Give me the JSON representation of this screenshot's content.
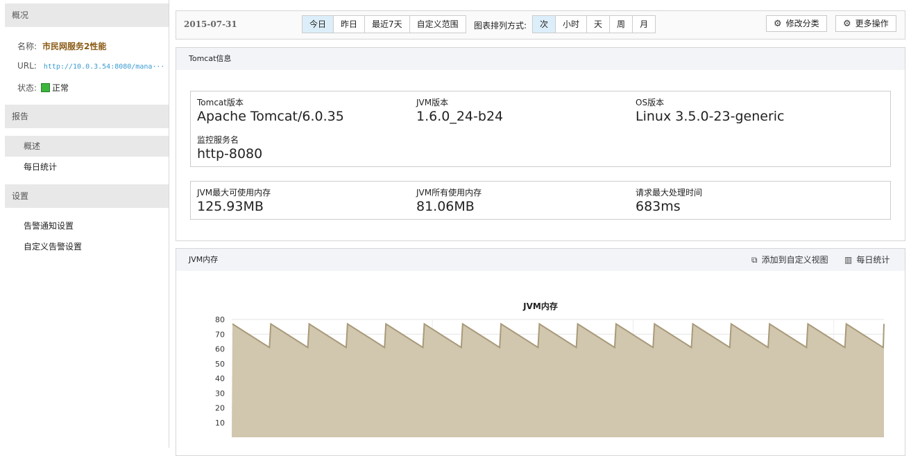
{
  "sidebar": {
    "overview_header": "概况",
    "name_label": "名称:",
    "name_value": "市民网服务2性能",
    "url_label": "URL:",
    "url_value": "http://10.0.3.54:8080/mana···",
    "status_label": "状态:",
    "status_value": "正常",
    "status_color": "#3cb53c",
    "report_header": "报告",
    "report_items": [
      "概述",
      "每日统计"
    ],
    "settings_header": "设置",
    "settings_items": [
      "告警通知设置",
      "自定义告警设置"
    ]
  },
  "toolbar": {
    "date": "2015-07-31",
    "range_options": [
      "今日",
      "昨日",
      "最近7天",
      "自定义范围"
    ],
    "range_selected": "今日",
    "sort_label": "图表排列方式:",
    "sort_options": [
      "次",
      "小时",
      "天",
      "周",
      "月"
    ],
    "sort_selected": "次",
    "modify_button": "修改分类",
    "more_button": "更多操作",
    "gear_icon": "gear-icon"
  },
  "tomcat_panel": {
    "title": "Tomcat信息",
    "tomcat_version_label": "Tomcat版本",
    "tomcat_version_value": "Apache Tomcat/6.0.35",
    "jvm_version_label": "JVM版本",
    "jvm_version_value": "1.6.0_24-b24",
    "os_version_label": "OS版本",
    "os_version_value": "Linux 3.5.0-23-generic",
    "service_label": "监控服务名",
    "service_value": "http-8080",
    "jvm_max_mem_label": "JVM最大可使用内存",
    "jvm_max_mem_value": "125.93MB",
    "jvm_used_mem_label": "JVM所有使用内存",
    "jvm_used_mem_value": "81.06MB",
    "max_req_time_label": "请求最大处理时间",
    "max_req_time_value": "683ms"
  },
  "jvm_panel": {
    "title": "JVM内存",
    "add_view_link": "添加到自定义视图",
    "daily_stats_link": "每日统计",
    "add_view_icon": "add-view-icon",
    "bar-chart-icon": "bar-chart-icon"
  },
  "chart_data": {
    "type": "area",
    "title": "JVM内存",
    "xlabel": "",
    "ylabel": "",
    "ylim": [
      0,
      80
    ],
    "yticks": [
      10,
      20,
      30,
      40,
      50,
      60,
      70,
      80
    ],
    "grid": true,
    "fill_color": "#d1c6ae",
    "line_color": "#a89a7a",
    "cycles": 17,
    "peak": 77,
    "trough": 61
  }
}
